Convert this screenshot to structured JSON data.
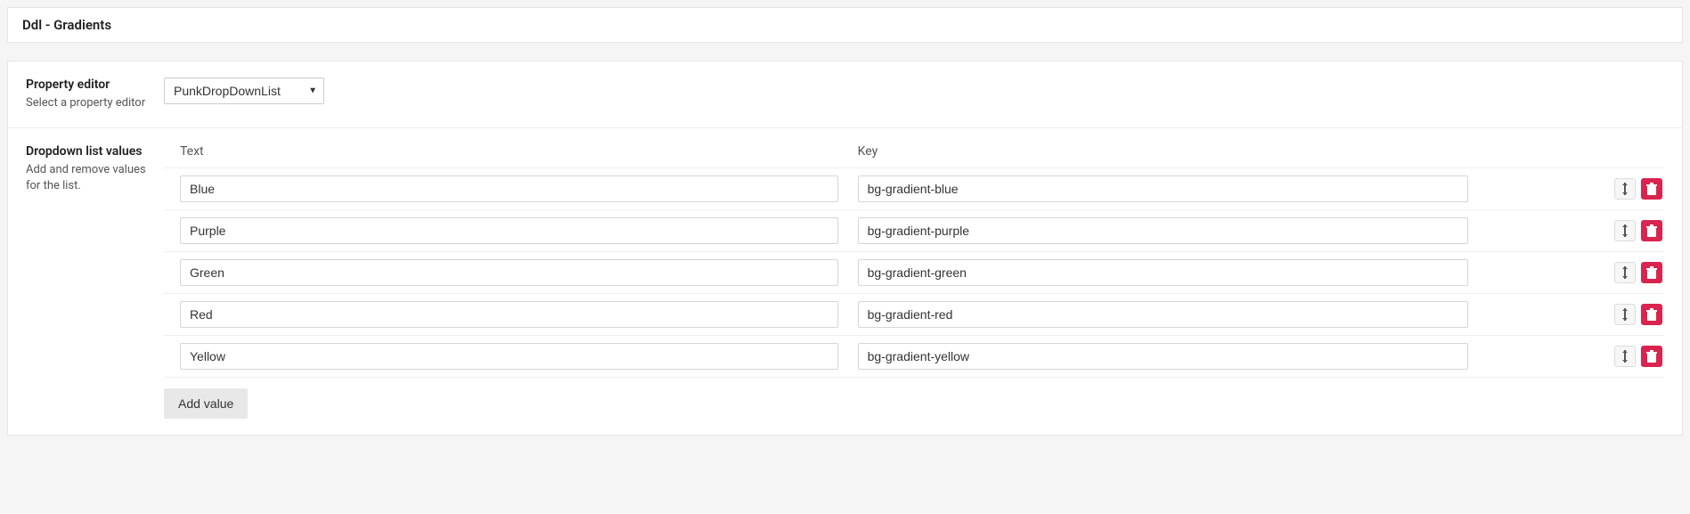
{
  "title": "Ddl - Gradients",
  "property_editor": {
    "label": "Property editor",
    "help": "Select a property editor",
    "selected": "PunkDropDownList"
  },
  "dropdown_values": {
    "label": "Dropdown list values",
    "help": "Add and remove values for the list.",
    "header_text": "Text",
    "header_key": "Key",
    "rows": [
      {
        "text": "Blue",
        "key": "bg-gradient-blue"
      },
      {
        "text": "Purple",
        "key": "bg-gradient-purple"
      },
      {
        "text": "Green",
        "key": "bg-gradient-green"
      },
      {
        "text": "Red",
        "key": "bg-gradient-red"
      },
      {
        "text": "Yellow",
        "key": "bg-gradient-yellow"
      }
    ],
    "add_label": "Add value"
  }
}
